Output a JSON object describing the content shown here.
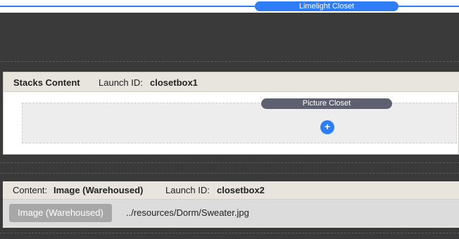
{
  "top_bar": {
    "pill_label": "Limelight  Closet",
    "accent_color": "#2f7df6"
  },
  "stacks_panel": {
    "title": "Stacks Content",
    "launch_label": "Launch ID:",
    "launch_id": "closetbox1",
    "picture_closet_label": "Picture  Closet",
    "add_button_glyph": "+",
    "add_button_icon": "plus-icon"
  },
  "content_panel": {
    "content_label": "Content:",
    "content_value": "Image (Warehoused)",
    "launch_label": "Launch ID:",
    "launch_id": "closetbox2",
    "image_button_label": "Image (Warehoused)",
    "image_path": "../resources/Dorm/Sweater.jpg"
  }
}
